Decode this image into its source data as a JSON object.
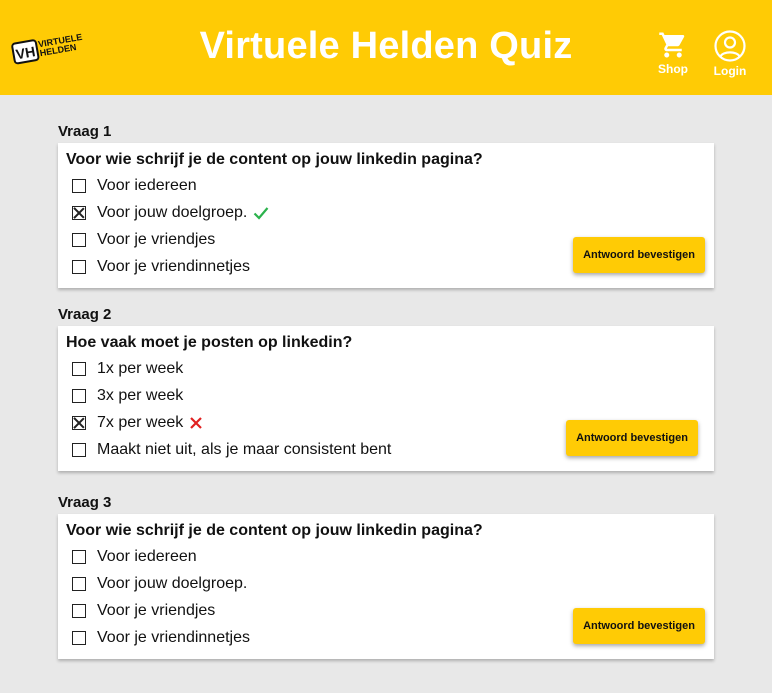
{
  "header": {
    "logo_text_line1": "VIRTUELE",
    "logo_text_line2": "HELDEN",
    "logo_monogram": "VH",
    "title": "Virtuele Helden Quiz",
    "nav": [
      {
        "label": "Shop",
        "icon": "cart-icon"
      },
      {
        "label": "Login",
        "icon": "user-icon"
      }
    ]
  },
  "colors": {
    "brand_yellow": "#ffcb05",
    "correct": "#2bb24c",
    "wrong": "#e02020",
    "background": "#e8e8e8"
  },
  "questions": [
    {
      "label": "Vraag 1",
      "text": "Voor wie schrijf je de content op jouw linkedin pagina?",
      "options": [
        {
          "text": "Voor iedereen",
          "checked": false,
          "mark": ""
        },
        {
          "text": "Voor jouw doelgroep.",
          "checked": true,
          "mark": "correct"
        },
        {
          "text": "Voor je vriendjes",
          "checked": false,
          "mark": ""
        },
        {
          "text": "Voor je vriendinnetjes",
          "checked": false,
          "mark": ""
        }
      ],
      "button": "Antwoord bevestigen"
    },
    {
      "label": "Vraag 2",
      "text": "Hoe vaak moet je posten op linkedin?",
      "options": [
        {
          "text": "1x per week",
          "checked": false,
          "mark": ""
        },
        {
          "text": "3x per week",
          "checked": false,
          "mark": ""
        },
        {
          "text": "7x per week",
          "checked": true,
          "mark": "wrong"
        },
        {
          "text": "Maakt niet uit, als je maar consistent bent",
          "checked": false,
          "mark": ""
        }
      ],
      "button": "Antwoord bevestigen"
    },
    {
      "label": "Vraag 3",
      "text": "Voor wie schrijf je de content op jouw linkedin pagina?",
      "options": [
        {
          "text": "Voor iedereen",
          "checked": false,
          "mark": ""
        },
        {
          "text": "Voor jouw doelgroep.",
          "checked": false,
          "mark": ""
        },
        {
          "text": "Voor je vriendjes",
          "checked": false,
          "mark": ""
        },
        {
          "text": "Voor je vriendinnetjes",
          "checked": false,
          "mark": ""
        }
      ],
      "button": "Antwoord bevestigen"
    }
  ]
}
